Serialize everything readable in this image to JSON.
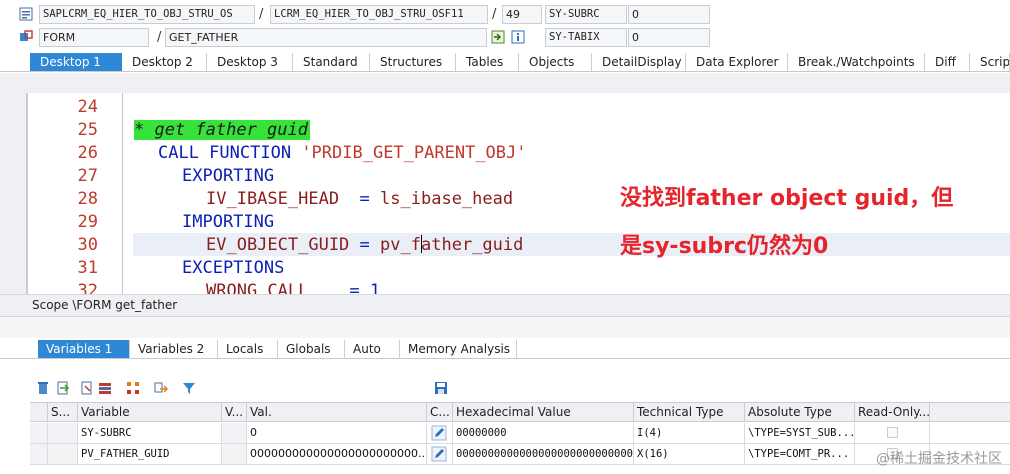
{
  "top": {
    "program": "SAPLCRM_EQ_HIER_TO_OBJ_STRU_OS",
    "include": "LCRM_EQ_HIER_TO_OBJ_STRU_OSF11",
    "line": "49",
    "sysubrc_label": "SY-SUBRC",
    "sysubrc_value": "0",
    "event_type": "FORM",
    "event_name": "GET_FATHER",
    "sytabix_label": "SY-TABIX",
    "sytabix_value": "0",
    "slash": "/"
  },
  "desktop_tabs": [
    "Desktop 1",
    "Desktop 2",
    "Desktop 3",
    "Standard",
    "Structures",
    "Tables",
    "Objects",
    "DetailDisplay",
    "Data Explorer",
    "Break./Watchpoints",
    "Diff",
    "Script"
  ],
  "editor": {
    "line_numbers": [
      "24",
      "25",
      "26",
      "27",
      "28",
      "29",
      "30",
      "31",
      "32"
    ],
    "l25_comment": "* get father guid",
    "l26_call": "CALL FUNCTION",
    "l26_fm": "'PRDIB_GET_PARENT_OBJ'",
    "l27_exporting": "EXPORTING",
    "l28_param": "IV_IBASE_HEAD",
    "l28_eq": "=",
    "l28_value": "ls_ibase_head",
    "l29_importing": "IMPORTING",
    "l30_param": "EV_OBJECT_GUID",
    "l30_eq": "=",
    "l30_value_a": "pv_f",
    "l30_value_b": "ather_guid",
    "l31_exceptions": "EXCEPTIONS",
    "l32_exc": "WRONG_CALL",
    "l32_eq": "=",
    "l32_value": "1",
    "annotation_line1": "没找到father object guid，但",
    "annotation_line2": "是sy-subrc仍然为0"
  },
  "scope": "Scope \\FORM get_father",
  "variable_tabs": [
    "Variables 1",
    "Variables 2",
    "Locals",
    "Globals",
    "Auto",
    "Memory Analysis"
  ],
  "table": {
    "headers": [
      "S...",
      "Variable",
      "V...",
      "Val.",
      "C...",
      "Hexadecimal Value",
      "Technical Type",
      "Absolute Type",
      "Read-Only..."
    ],
    "rows": [
      {
        "variable": "SY-SUBRC",
        "value": "0",
        "hex": "00000000",
        "tech": "I(4)",
        "abs": "\\TYPE=SYST_SUB..."
      },
      {
        "variable": "PV_FATHER_GUID",
        "value": "000000000000000000000000...",
        "hex": "00000000000000000000000000000...",
        "tech": "X(16)",
        "abs": "\\TYPE=COMT_PR..."
      }
    ]
  },
  "watermark": "@稀土掘金技术社区",
  "colors": {
    "tab_active": "#2f88d6",
    "comment_bg": "#37e23a",
    "keyword": "#0b1fb5",
    "string": "#c0392b",
    "annotation": "#e5242b"
  }
}
